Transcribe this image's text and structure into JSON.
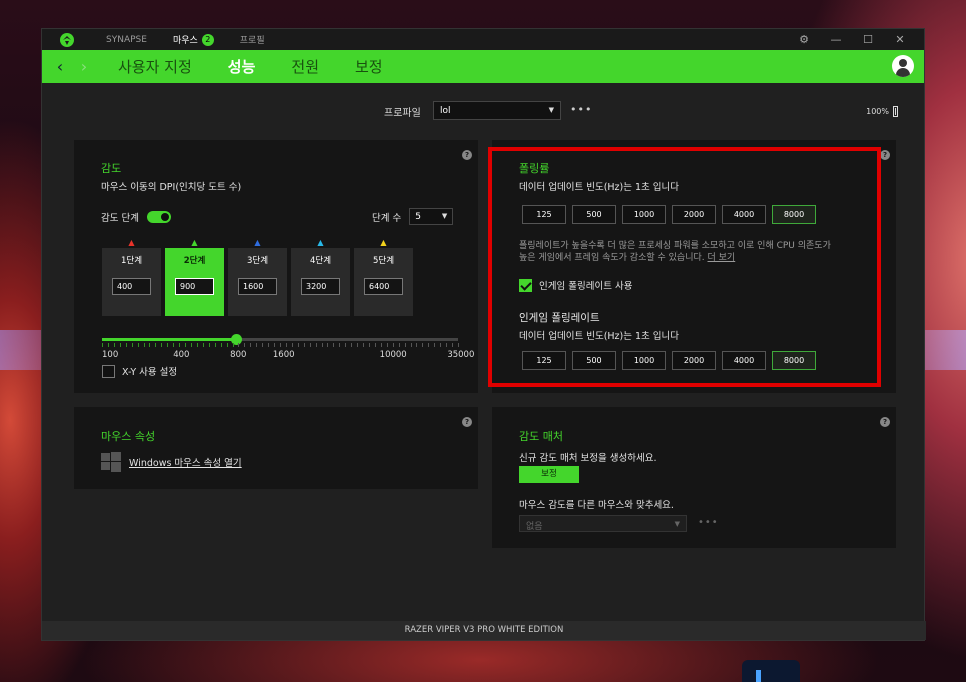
{
  "titlebar": {
    "tabs": [
      {
        "label": "SYNAPSE"
      },
      {
        "label": "마우스",
        "badge": "2"
      },
      {
        "label": "프로필"
      }
    ]
  },
  "nav": {
    "items": [
      "사용자 지정",
      "성능",
      "전원",
      "보정"
    ],
    "active": "성능"
  },
  "profile": {
    "label": "프로파일",
    "selected": "lol",
    "battery": "100%"
  },
  "sensitivity": {
    "title": "감도",
    "subtitle": "마우스 이동의 DPI(인치당 도트 수)",
    "stages_label": "감도 단계",
    "step_count_label": "단계 수",
    "step_count": "5",
    "stages": [
      {
        "name": "1단계",
        "value": "400",
        "color": "#e8332a"
      },
      {
        "name": "2단계",
        "value": "900",
        "color": "#44d62c"
      },
      {
        "name": "3단계",
        "value": "1600",
        "color": "#2f6de0"
      },
      {
        "name": "4단계",
        "value": "3200",
        "color": "#28b8e8"
      },
      {
        "name": "5단계",
        "value": "6400",
        "color": "#f2d21c"
      }
    ],
    "active_stage": 1,
    "slider_value": 900,
    "tick_labels": [
      "100",
      "400",
      "800",
      "1600",
      "10000",
      "35000"
    ],
    "xy_label": "X-Y 사용 설정"
  },
  "polling": {
    "title": "폴링률",
    "subtitle": "데이터 업데이트 빈도(Hz)는 1초 입니다",
    "rates": [
      "125",
      "500",
      "1000",
      "2000",
      "4000",
      "8000"
    ],
    "selected": "8000",
    "note_line1": "폴링레이트가 높을수록 더 많은 프로세싱 파워를 소모하고 이로 인해 CPU 의존도가",
    "note_line2": "높은 게임에서 프레임 속도가 감소할 수 있습니다.",
    "more_link": "더 보기",
    "ingame_check_label": "인게임 폴링레이트 사용",
    "ingame_title": "인게임 폴링레이트",
    "ingame_subtitle": "데이터 업데이트 빈도(Hz)는 1초 입니다",
    "ingame_rates": [
      "125",
      "500",
      "1000",
      "2000",
      "4000",
      "8000"
    ],
    "ingame_selected": "8000"
  },
  "mouse_props": {
    "title": "마우스 속성",
    "link": "Windows 마우스 속성 열기"
  },
  "matcher": {
    "title": "감도 매처",
    "line1": "신규 감도 매처 보정을 생성하세요.",
    "button": "보정",
    "line2": "마우스 감도를 다른 마우스와 맞추세요.",
    "select_value": "없음"
  },
  "status": "RAZER VIPER V3 PRO WHITE EDITION"
}
